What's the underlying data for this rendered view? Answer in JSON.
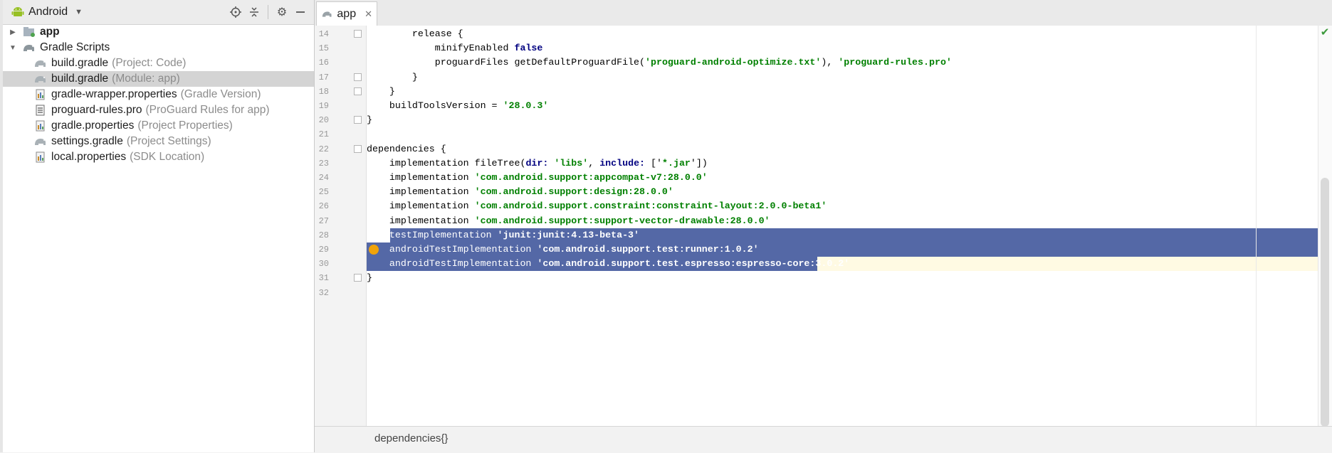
{
  "project_pane": {
    "title": "Android",
    "tree": [
      {
        "name": "app",
        "hint": "",
        "bold": true,
        "level": 0,
        "expanded": false,
        "icon": "app-module-icon"
      },
      {
        "name": "Gradle Scripts",
        "hint": "",
        "bold": false,
        "level": 0,
        "expanded": true,
        "icon": "gradle-scripts-icon"
      },
      {
        "name": "build.gradle",
        "hint": "(Project: Code)",
        "bold": false,
        "level": 1,
        "icon": "gradle-icon"
      },
      {
        "name": "build.gradle",
        "hint": "(Module: app)",
        "bold": false,
        "level": 1,
        "selected": true,
        "icon": "gradle-icon"
      },
      {
        "name": "gradle-wrapper.properties",
        "hint": "(Gradle Version)",
        "bold": false,
        "level": 1,
        "icon": "properties-icon"
      },
      {
        "name": "proguard-rules.pro",
        "hint": "(ProGuard Rules for app)",
        "bold": false,
        "level": 1,
        "icon": "text-file-icon"
      },
      {
        "name": "gradle.properties",
        "hint": "(Project Properties)",
        "bold": false,
        "level": 1,
        "icon": "properties-icon"
      },
      {
        "name": "settings.gradle",
        "hint": "(Project Settings)",
        "bold": false,
        "level": 1,
        "icon": "gradle-icon"
      },
      {
        "name": "local.properties",
        "hint": "(SDK Location)",
        "bold": false,
        "level": 1,
        "icon": "properties-icon"
      }
    ]
  },
  "editor": {
    "tab_label": "app",
    "breadcrumb": "dependencies{}",
    "lines": [
      {
        "n": "14",
        "segs": [
          {
            "t": "        release {"
          }
        ]
      },
      {
        "n": "15",
        "segs": [
          {
            "t": "            minifyEnabled "
          },
          {
            "t": "false",
            "c": "kw"
          }
        ]
      },
      {
        "n": "16",
        "segs": [
          {
            "t": "            proguardFiles getDefaultProguardFile("
          },
          {
            "t": "'proguard-android-optimize.txt'",
            "c": "str"
          },
          {
            "t": "), "
          },
          {
            "t": "'proguard-rules.pro'",
            "c": "str"
          }
        ]
      },
      {
        "n": "17",
        "segs": [
          {
            "t": "        }"
          }
        ]
      },
      {
        "n": "18",
        "segs": [
          {
            "t": "    }"
          }
        ]
      },
      {
        "n": "19",
        "segs": [
          {
            "t": "    buildToolsVersion = "
          },
          {
            "t": "'28.0.3'",
            "c": "str"
          }
        ]
      },
      {
        "n": "20",
        "segs": [
          {
            "t": "}"
          }
        ]
      },
      {
        "n": "21",
        "segs": []
      },
      {
        "n": "22",
        "segs": [
          {
            "t": "dependencies {"
          }
        ]
      },
      {
        "n": "23",
        "segs": [
          {
            "t": "    implementation fileTree("
          },
          {
            "t": "dir: ",
            "c": "kw"
          },
          {
            "t": "'libs'",
            "c": "str"
          },
          {
            "t": ", "
          },
          {
            "t": "include: ",
            "c": "kw"
          },
          {
            "t": "['"
          },
          {
            "t": "*.jar",
            "c": "str"
          },
          {
            "t": "'])"
          }
        ]
      },
      {
        "n": "24",
        "segs": [
          {
            "t": "    implementation "
          },
          {
            "t": "'com.android.support:appcompat-v7:28.0.0'",
            "c": "str"
          }
        ]
      },
      {
        "n": "25",
        "segs": [
          {
            "t": "    implementation "
          },
          {
            "t": "'com.android.support:design:28.0.0'",
            "c": "str"
          }
        ]
      },
      {
        "n": "26",
        "segs": [
          {
            "t": "    implementation "
          },
          {
            "t": "'com.android.support.constraint:constraint-layout:2.0.0-beta1'",
            "c": "str"
          }
        ]
      },
      {
        "n": "27",
        "segs": [
          {
            "t": "    implementation "
          },
          {
            "t": "'com.android.support:support-vector-drawable:28.0.0'",
            "c": "str"
          }
        ]
      },
      {
        "n": "28",
        "segs": [
          {
            "t": "    testImplementation "
          },
          {
            "t": "'junit:junit:4.13-beta-3'",
            "c": "str"
          }
        ],
        "selected": true
      },
      {
        "n": "29",
        "segs": [
          {
            "t": "    androidTestImplementation "
          },
          {
            "t": "'com.android.support.test:runner:1.0.2'",
            "c": "str"
          }
        ],
        "selected": true
      },
      {
        "n": "30",
        "segs": [
          {
            "t": "    androidTestImplementation "
          },
          {
            "t": "'com.android.support.test.espresso:espresso-core:3.0.2'",
            "c": "str"
          }
        ],
        "selected": true
      },
      {
        "n": "31",
        "segs": [
          {
            "t": "}"
          }
        ]
      },
      {
        "n": "32",
        "segs": []
      }
    ]
  }
}
